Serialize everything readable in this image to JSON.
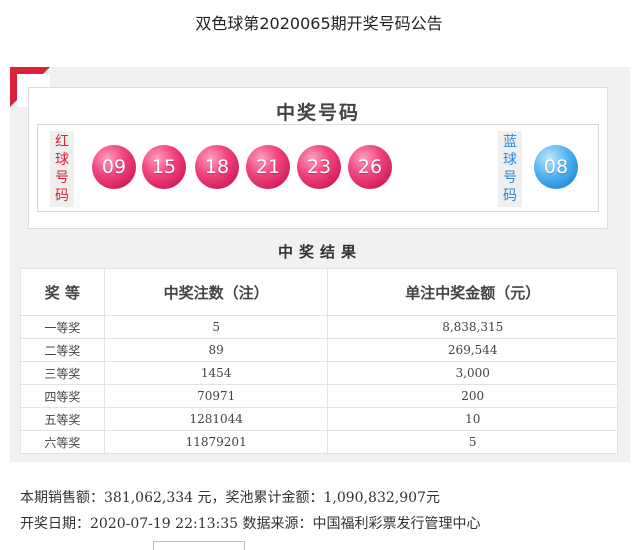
{
  "page": {
    "title": "双色球第2020065期开奖号码公告"
  },
  "winning_numbers": {
    "title": "中奖号码",
    "red_label": "红球号码",
    "blue_label": "蓝球号码",
    "red_balls": [
      "09",
      "15",
      "18",
      "21",
      "23",
      "26"
    ],
    "blue_ball": "08",
    "colors": {
      "red_accent": "#d8233a",
      "red_ball": "#e8356e",
      "blue_ball": "#2e98e3",
      "blue_accent": "#2a8ad8"
    }
  },
  "results": {
    "title": "中奖结果",
    "headers": [
      "奖 等",
      "中奖注数（注）",
      "单注中奖金额（元）"
    ],
    "rows": [
      {
        "level": "一等奖",
        "count": "5",
        "amount": "8,838,315"
      },
      {
        "level": "二等奖",
        "count": "89",
        "amount": "269,544"
      },
      {
        "level": "三等奖",
        "count": "1454",
        "amount": "3,000"
      },
      {
        "level": "四等奖",
        "count": "70971",
        "amount": "200"
      },
      {
        "level": "五等奖",
        "count": "1281044",
        "amount": "10"
      },
      {
        "level": "六等奖",
        "count": "11879201",
        "amount": "5"
      }
    ]
  },
  "summary": {
    "sales_line": "本期销售额：381,062,334 元，奖池累计金额：1,090,832,907元",
    "date_line": "开奖日期：2020-07-19 22:13:35 数据来源：中国福利彩票发行管理中心"
  }
}
